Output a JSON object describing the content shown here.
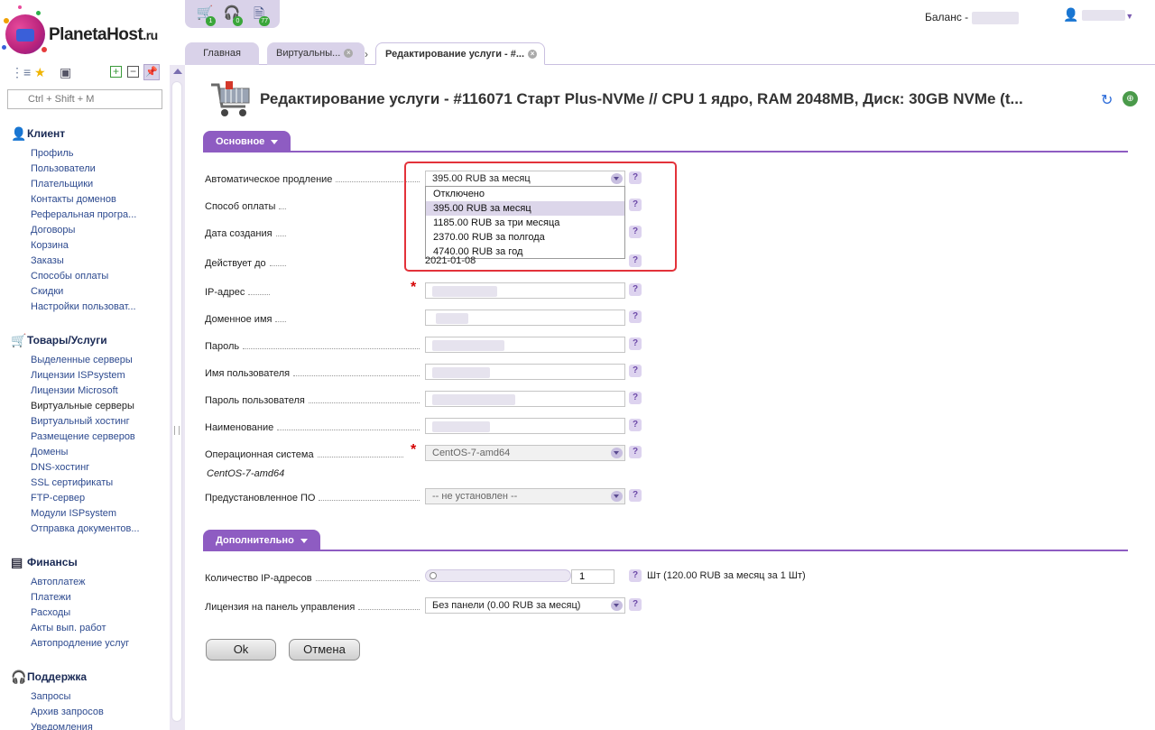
{
  "brand": {
    "name": "PlanetaHost",
    "tld": ".ru"
  },
  "toolbar": {
    "cart_count": "1",
    "support_count": "0",
    "docs_count": "77"
  },
  "header": {
    "balance_label": "Баланс -"
  },
  "search": {
    "placeholder": "Ctrl + Shift + M"
  },
  "nav": {
    "client": {
      "title": "Клиент",
      "items": [
        "Профиль",
        "Пользователи",
        "Плательщики",
        "Контакты доменов",
        "Реферальная програ...",
        "Договоры",
        "Корзина",
        "Заказы",
        "Способы оплаты",
        "Скидки",
        "Настройки пользоват..."
      ]
    },
    "goods": {
      "title": "Товары/Услуги",
      "items": [
        "Выделенные серверы",
        "Лицензии ISPsystem",
        "Лицензии Microsoft",
        "Виртуальные серверы",
        "Виртуальный хостинг",
        "Размещение серверов",
        "Домены",
        "DNS-хостинг",
        "SSL сертификаты",
        "FTP-сервер",
        "Модули ISPsystem",
        "Отправка документов..."
      ]
    },
    "finance": {
      "title": "Финансы",
      "items": [
        "Автоплатеж",
        "Платежи",
        "Расходы",
        "Акты вып. работ",
        "Автопродление услуг"
      ]
    },
    "support": {
      "title": "Поддержка",
      "items": [
        "Запросы",
        "Архив запросов",
        "Уведомления"
      ]
    }
  },
  "tabs": [
    {
      "label": "Главная"
    },
    {
      "label": "Виртуальны..."
    },
    {
      "label": "Редактирование услуги - #..."
    }
  ],
  "page": {
    "title": "Редактирование услуги - #116071 Старт Plus-NVMe // CPU 1 ядро, RAM 2048MB, Диск: 30GB NVMe (t..."
  },
  "sections": {
    "main": "Основное",
    "extra": "Дополнительно"
  },
  "form": {
    "autorenew": {
      "label": "Автоматическое продление",
      "value": "395.00 RUB за месяц",
      "options": [
        "Отключено",
        "395.00 RUB за месяц",
        "1185.00 RUB за три месяца",
        "2370.00 RUB за полгода",
        "4740.00 RUB за год"
      ]
    },
    "payment_method": {
      "label": "Способ оплаты"
    },
    "created": {
      "label": "Дата создания"
    },
    "valid_until": {
      "label": "Действует до",
      "value": "2021-01-08"
    },
    "ip": {
      "label": "IP-адрес"
    },
    "domain": {
      "label": "Доменное имя"
    },
    "password": {
      "label": "Пароль"
    },
    "username": {
      "label": "Имя пользователя"
    },
    "user_password": {
      "label": "Пароль пользователя"
    },
    "name": {
      "label": "Наименование"
    },
    "os": {
      "label": "Операционная система",
      "value": "CentOS-7-amd64",
      "note": "CentOS-7-amd64"
    },
    "preinstalled": {
      "label": "Предустановленное ПО",
      "value": "-- не установлен --"
    },
    "ip_count": {
      "label": "Количество IP-адресов",
      "value": "1",
      "unit": "Шт (120.00 RUB за месяц за 1 Шт)",
      "slider_fraction": 0.0
    },
    "license": {
      "label": "Лицензия на панель управления",
      "value": "Без панели (0.00 RUB за месяц)"
    }
  },
  "buttons": {
    "ok": "Ok",
    "cancel": "Отмена"
  },
  "help_glyph": "?",
  "colors": {
    "accent": "#8e5cc2",
    "highlight": "#e3323a",
    "link": "#2d4a8f"
  }
}
